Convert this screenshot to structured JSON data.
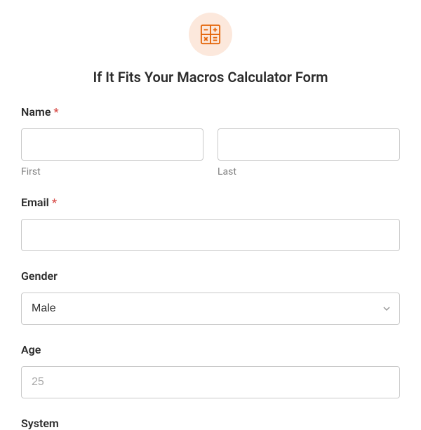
{
  "title": "If It Fits Your Macros Calculator Form",
  "name": {
    "label": "Name",
    "required": "*",
    "first_sublabel": "First",
    "last_sublabel": "Last"
  },
  "email": {
    "label": "Email",
    "required": "*"
  },
  "gender": {
    "label": "Gender",
    "value": "Male"
  },
  "age": {
    "label": "Age",
    "placeholder": "25"
  },
  "system": {
    "label": "System"
  }
}
